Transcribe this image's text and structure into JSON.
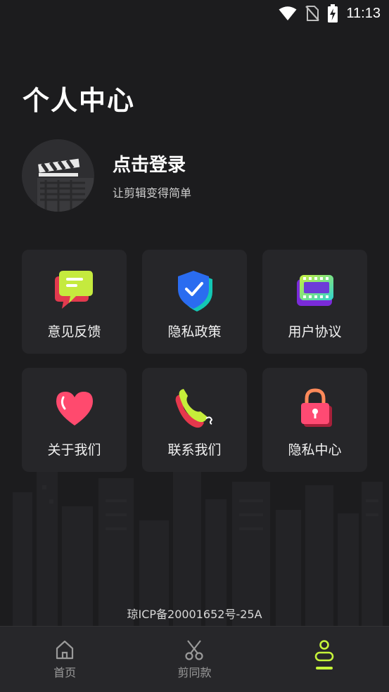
{
  "status_bar": {
    "time": "11:13",
    "icons": [
      "wifi-icon",
      "no-sim-icon",
      "battery-charging-icon"
    ]
  },
  "page": {
    "title": "个人中心"
  },
  "profile": {
    "login_label": "点击登录",
    "subtitle": "让剪辑变得简单",
    "avatar_icon": "clapperboard-icon"
  },
  "menu": {
    "items": [
      {
        "label": "意见反馈",
        "icon": "feedback-message-icon"
      },
      {
        "label": "隐私政策",
        "icon": "shield-check-icon"
      },
      {
        "label": "用户协议",
        "icon": "film-icon"
      },
      {
        "label": "关于我们",
        "icon": "heart-icon"
      },
      {
        "label": "联系我们",
        "icon": "phone-icon"
      },
      {
        "label": "隐私中心",
        "icon": "lock-icon"
      }
    ]
  },
  "footer": {
    "icp": "琼ICP备20001652号-25A"
  },
  "tab_bar": {
    "tabs": [
      {
        "label": "首页",
        "icon": "home-icon",
        "active": false
      },
      {
        "label": "剪同款",
        "icon": "scissors-icon",
        "active": false
      },
      {
        "label": "",
        "icon": "user-icon",
        "active": true
      }
    ]
  },
  "colors": {
    "background": "#1c1c1e",
    "tile": "#262629",
    "accent": "#c6f43a"
  }
}
